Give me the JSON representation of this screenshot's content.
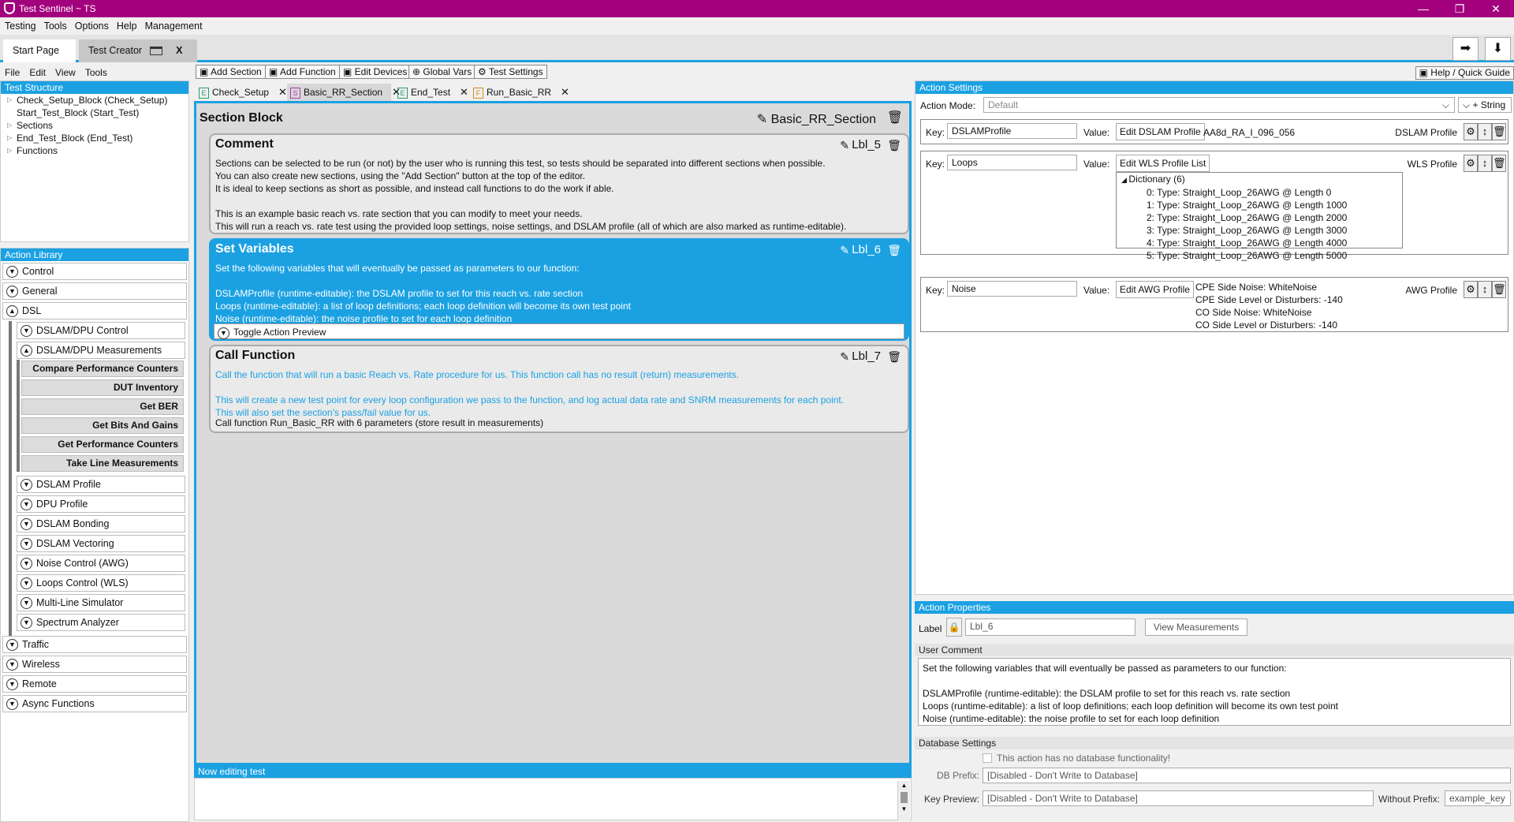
{
  "window": {
    "title": "Test Sentinel ~ TS",
    "min": "—",
    "restore": "❐",
    "close": "✕"
  },
  "menubar": [
    "Testing",
    "Tools",
    "Options",
    "Help",
    "Management"
  ],
  "app_tabs": {
    "start": "Start Page",
    "creator": "Test Creator",
    "close": "X"
  },
  "left_menu": [
    "File",
    "Edit",
    "View",
    "Tools"
  ],
  "test_structure": {
    "title": "Test Structure",
    "items": [
      "Check_Setup_Block (Check_Setup)",
      "Start_Test_Block (Start_Test)",
      "Sections",
      "End_Test_Block (End_Test)",
      "Functions"
    ]
  },
  "action_library": {
    "title": "Action Library",
    "top": [
      "Control",
      "General",
      "DSL"
    ],
    "dsl_groups": [
      "DSLAM/DPU Control",
      "DSLAM/DPU Measurements"
    ],
    "measure_items": [
      "Compare Performance Counters",
      "DUT Inventory",
      "Get BER",
      "Get Bits And Gains",
      "Get Performance Counters",
      "Take Line Measurements"
    ],
    "dsl_more": [
      "DSLAM Profile",
      "DPU Profile",
      "DSLAM Bonding",
      "DSLAM Vectoring",
      "Noise Control (AWG)",
      "Loops Control (WLS)",
      "Multi-Line Simulator",
      "Spectrum Analyzer"
    ],
    "bottom": [
      "Traffic",
      "Wireless",
      "Remote",
      "Async Functions"
    ]
  },
  "editor_toolbar": [
    "Add Section",
    "Add Function",
    "Edit Devices",
    "Global Vars",
    "Test Settings"
  ],
  "editor_tabs": [
    {
      "icon": "E",
      "label": "Check_Setup"
    },
    {
      "icon": "S",
      "label": "Basic_RR_Section"
    },
    {
      "icon": "E",
      "label": "End_Test"
    },
    {
      "icon": "F",
      "label": "Run_Basic_RR"
    }
  ],
  "section": {
    "title": "Section Block",
    "name": "Basic_RR_Section"
  },
  "blocks": {
    "comment": {
      "title": "Comment",
      "label": "Lbl_5",
      "text": "Sections can be selected to be run (or not) by the user who is running this test, so tests should be separated into different sections when possible.\nYou can also create new sections, using the \"Add Section\" button at the top of the editor.\nIt is ideal to keep sections as short as possible, and instead call functions to do the work if able.\n\nThis is an example basic reach vs. rate section that you can modify to meet your needs.\nThis will run a reach vs. rate test using the provided loop settings, noise settings, and DSLAM profile (all of which are also marked as runtime-editable)."
    },
    "setvars": {
      "title": "Set Variables",
      "label": "Lbl_6",
      "text": "Set the following variables that will eventually be passed as parameters to our function:\n\nDSLAMProfile (runtime-editable): the DSLAM profile to set for this reach vs. rate section\nLoops (runtime-editable): a list of loop definitions; each loop definition will become its own test point\nNoise (runtime-editable): the noise profile to set for each loop definition",
      "toggle": "Toggle Action Preview"
    },
    "callfn": {
      "title": "Call Function",
      "label": "Lbl_7",
      "text": "Call the function that will run a basic Reach vs. Rate procedure for us. This function call has no result (return) measurements.\n\nThis will create a new test point for every loop configuration we pass to the function, and log actual data rate and SNRM measurements for each point.\nThis will also set the section's pass/fail value for us.",
      "call": "Call function Run_Basic_RR with 6 parameters (store result in measurements)"
    }
  },
  "status": "Now editing test",
  "help": "Help / Quick Guide",
  "action_settings": {
    "title": "Action Settings",
    "mode_label": "Action Mode:",
    "mode_value": "Default",
    "add": "String",
    "rows": [
      {
        "key_label": "Key:",
        "key": "DSLAMProfile",
        "value_label": "Value:",
        "button": "Edit DSLAM Profile",
        "value": "AA8d_RA_I_096_056",
        "type": "DSLAM Profile"
      },
      {
        "key_label": "Key:",
        "key": "Loops",
        "value_label": "Value:",
        "button": "Edit WLS Profile List",
        "type": "WLS Profile",
        "dict_title": "Dictionary (6)",
        "dict": [
          "0: Type: Straight_Loop_26AWG @ Length 0",
          "1: Type: Straight_Loop_26AWG @ Length 1000",
          "2: Type: Straight_Loop_26AWG @ Length 2000",
          "3: Type: Straight_Loop_26AWG @ Length 3000",
          "4: Type: Straight_Loop_26AWG @ Length 4000",
          "5: Type: Straight_Loop_26AWG @ Length 5000"
        ]
      },
      {
        "key_label": "Key:",
        "key": "Noise",
        "value_label": "Value:",
        "button": "Edit AWG Profile",
        "type": "AWG Profile",
        "lines": [
          "CPE Side Noise: WhiteNoise",
          "CPE Side Level or Disturbers: -140",
          "CO Side Noise: WhiteNoise",
          "CO Side Level or Disturbers: -140"
        ]
      }
    ]
  },
  "action_properties": {
    "title": "Action Properties",
    "label_label": "Label",
    "label_value": "Lbl_6",
    "view": "View Measurements"
  },
  "user_comment": {
    "title": "User Comment",
    "text": "Set the following variables that will eventually be passed as parameters to our function:\n\nDSLAMProfile (runtime-editable): the DSLAM profile to set for this reach vs. rate section\nLoops (runtime-editable): a list of loop definitions; each loop definition will become its own test point\nNoise (runtime-editable): the noise profile to set for each loop definition"
  },
  "database": {
    "title": "Database Settings",
    "no_db": "This action has no database functionality!",
    "prefix_label": "DB Prefix:",
    "prefix": "[Disabled - Don't Write to Database]",
    "preview_label": "Key Preview:",
    "preview": "[Disabled - Don't Write to Database]",
    "without_label": "Without Prefix:",
    "without": "example_key"
  }
}
